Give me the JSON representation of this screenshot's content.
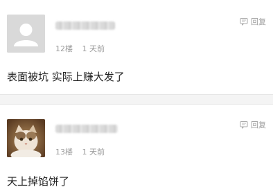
{
  "comments": [
    {
      "floor": "12楼",
      "time": "1 天前",
      "reply_label": "回复",
      "text": "表面被坑  实际上赚大发了"
    },
    {
      "floor": "13楼",
      "time": "1 天前",
      "reply_label": "回复",
      "text": "天上掉馅饼了"
    }
  ],
  "icons": {
    "reply": "reply-icon",
    "avatar_default": "default-avatar-icon"
  },
  "colors": {
    "meta_text": "#999999",
    "separator": "#f4f4f4"
  }
}
